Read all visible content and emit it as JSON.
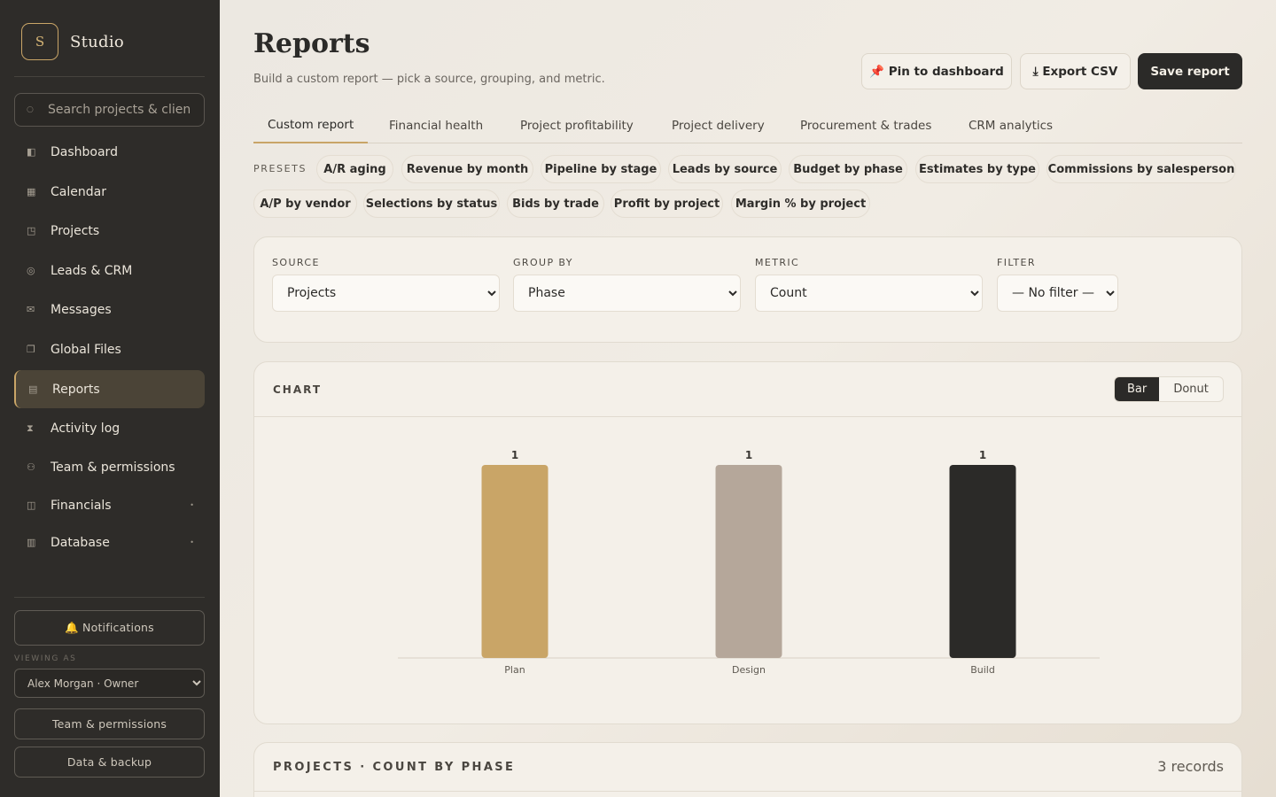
{
  "brand": {
    "logo_letter": "S",
    "name": "Studio"
  },
  "sidebar": {
    "search_placeholder": "Search projects & clients",
    "items": [
      {
        "label": "Dashboard",
        "icon": "dashboard-icon",
        "glyph": "◧"
      },
      {
        "label": "Calendar",
        "icon": "calendar-icon",
        "glyph": "▦"
      },
      {
        "label": "Projects",
        "icon": "projects-icon",
        "glyph": "◳"
      },
      {
        "label": "Leads & CRM",
        "icon": "crm-icon",
        "glyph": "◎"
      },
      {
        "label": "Messages",
        "icon": "messages-icon",
        "glyph": "✉"
      },
      {
        "label": "Global Files",
        "icon": "files-icon",
        "glyph": "❐"
      },
      {
        "label": "Reports",
        "icon": "reports-icon",
        "glyph": "▤"
      },
      {
        "label": "Activity log",
        "icon": "activity-icon",
        "glyph": "⧗"
      },
      {
        "label": "Team & permissions",
        "icon": "team-icon",
        "glyph": "⚇"
      },
      {
        "label": "Financials",
        "icon": "financials-icon",
        "glyph": "◫"
      },
      {
        "label": "Database",
        "icon": "database-icon",
        "glyph": "▥"
      }
    ],
    "notifications_label": "🔔 Notifications",
    "viewing_as_label": "VIEWING AS",
    "viewing_as_value": "Alex Morgan · Owner",
    "team_button": "Team & permissions",
    "backup_button": "Data & backup"
  },
  "header": {
    "title": "Reports",
    "subtitle": "Build a custom report — pick a source, grouping, and metric.",
    "pin_label": "📌 Pin to dashboard",
    "export_label": "⤓ Export CSV",
    "save_label": "Save report"
  },
  "tabs": [
    "Custom report",
    "Financial health",
    "Project profitability",
    "Project delivery",
    "Procurement & trades",
    "CRM analytics"
  ],
  "presets": {
    "label": "PRESETS",
    "items": [
      "A/R aging",
      "Revenue by month",
      "Pipeline by stage",
      "Leads by source",
      "Budget by phase",
      "Estimates by type",
      "Commissions by salesperson",
      "A/P by vendor",
      "Selections by status",
      "Bids by trade",
      "Profit by project",
      "Margin % by project"
    ]
  },
  "builder": {
    "source_label": "SOURCE",
    "source_value": "Projects",
    "group_label": "GROUP BY",
    "group_value": "Phase",
    "metric_label": "METRIC",
    "metric_value": "Count",
    "filter_label": "FILTER",
    "filter_value": "— No filter —"
  },
  "chart_panel": {
    "title": "CHART",
    "bar_label": "Bar",
    "donut_label": "Donut"
  },
  "chart_data": {
    "type": "bar",
    "categories": [
      "Plan",
      "Design",
      "Build"
    ],
    "values": [
      1,
      1,
      1
    ],
    "colors": [
      "#c9a567",
      "#b5a79a",
      "#2b2a28"
    ],
    "ylim": [
      0,
      1
    ]
  },
  "records": {
    "title": "PROJECTS · COUNT BY PHASE",
    "count": "3 records"
  }
}
